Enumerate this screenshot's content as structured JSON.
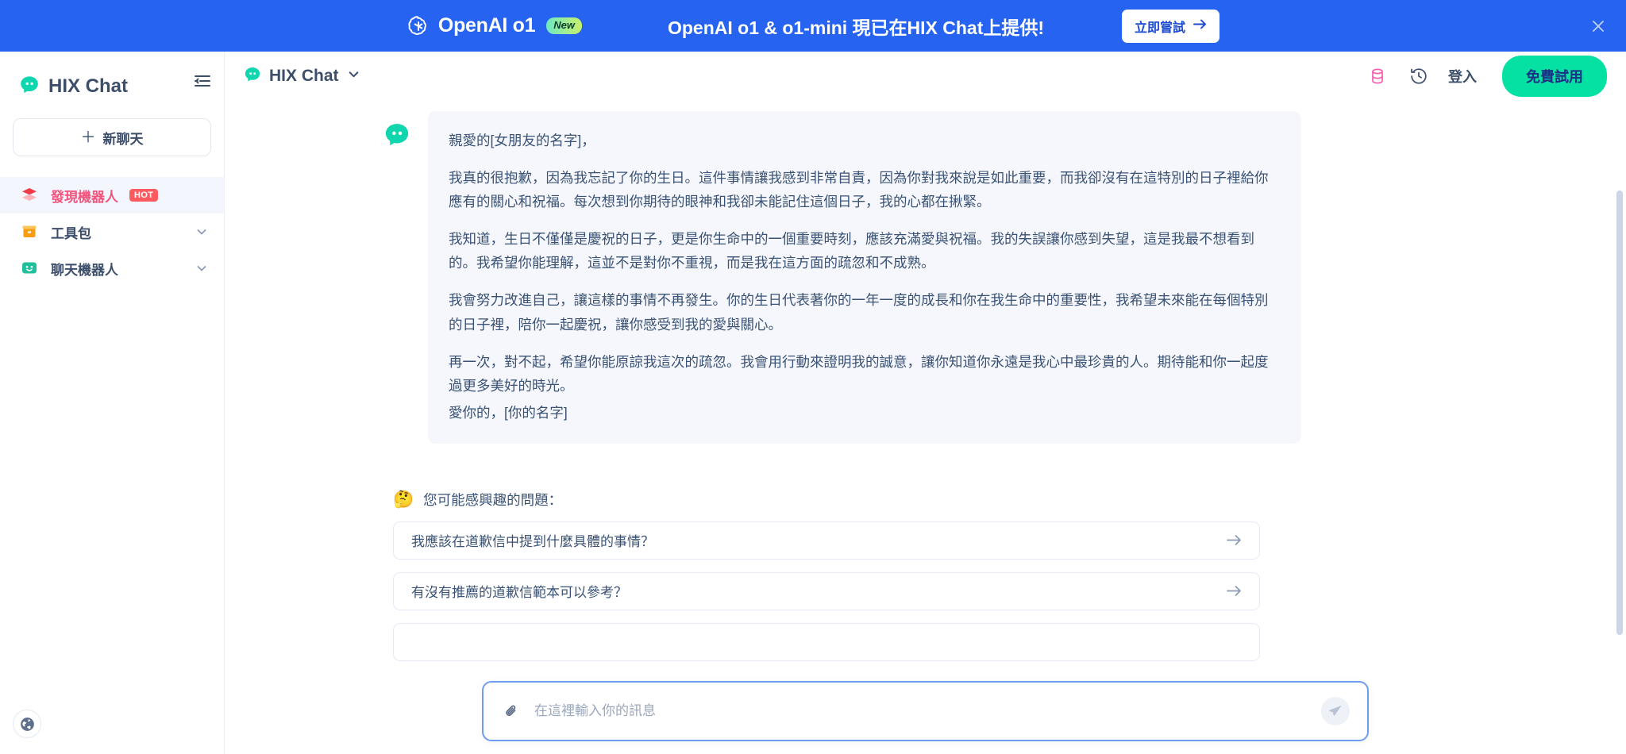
{
  "banner": {
    "brand": "OpenAI o1",
    "new_badge": "New",
    "message": "OpenAI o1 & o1-mini 現已在HIX Chat上提供!",
    "cta_label": "立即嘗試",
    "close_icon": "close-icon",
    "bg_color": "#2563f0"
  },
  "sidebar": {
    "brand": "HIX Chat",
    "collapse_icon": "sidebar-collapse-icon",
    "new_chat_label": "新聊天",
    "items": [
      {
        "label": "發現機器人",
        "badge": "HOT",
        "icon": "layers-icon",
        "active": true,
        "chevron": false
      },
      {
        "label": "工具包",
        "badge": "",
        "icon": "toolbox-icon",
        "active": false,
        "chevron": true
      },
      {
        "label": "聊天機器人",
        "badge": "",
        "icon": "smiley-chat-icon",
        "active": false,
        "chevron": true
      }
    ],
    "globe_icon": "globe-icon",
    "active_color": "#f2547d"
  },
  "header": {
    "model_name": "HIX Chat",
    "model_icon": "hix-chat-logo-icon",
    "dropdown_icon": "chevron-down-icon",
    "database_icon": "database-icon",
    "history_icon": "history-clock-icon",
    "login_label": "登入",
    "free_trial_label": "免費試用",
    "free_trial_color": "#05e1a3"
  },
  "message": {
    "avatar_icon": "assistant-bubble-icon",
    "greeting": "親愛的[女朋友的名字]，",
    "paragraphs": [
      "我真的很抱歉，因為我忘記了你的生日。這件事情讓我感到非常自責，因為你對我來說是如此重要，而我卻沒有在這特別的日子裡給你應有的關心和祝福。每次想到你期待的眼神和我卻未能記住這個日子，我的心都在揪緊。",
      "我知道，生日不僅僅是慶祝的日子，更是你生命中的一個重要時刻，應該充滿愛與祝福。我的失誤讓你感到失望，這是我最不想看到的。我希望你能理解，這並不是對你不重視，而是我在這方面的疏忽和不成熟。",
      "我會努力改進自己，讓這樣的事情不再發生。你的生日代表著你的一年一度的成長和你在我生命中的重要性，我希望未來能在每個特別的日子裡，陪你一起慶祝，讓你感受到我的愛與關心。",
      "再一次，對不起，希望你能原諒我這次的疏忽。我會用行動來證明我的誠意，讓你知道你永遠是我心中最珍貴的人。期待能和你一起度過更多美好的時光。"
    ],
    "signature": "愛你的，[你的名字]"
  },
  "suggestions": {
    "emoji": "🤔",
    "title": "您可能感興趣的問題：",
    "arrow_icon": "arrow-right-icon",
    "items": [
      "我應該在道歉信中提到什麼具體的事情？",
      "有沒有推薦的道歉信範本可以參考？"
    ]
  },
  "composer": {
    "attach_icon": "paperclip-icon",
    "placeholder": "在這裡輸入你的訊息",
    "value": "",
    "send_icon": "send-icon"
  }
}
